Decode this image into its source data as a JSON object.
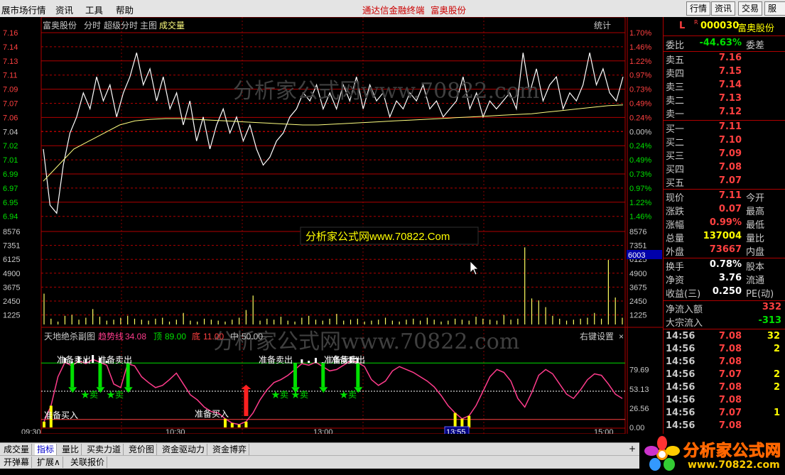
{
  "menubar": {
    "items": [
      "展市场行情",
      "资讯",
      "工具",
      "帮助"
    ],
    "title_app": "通达信金融终端",
    "title_stock": "富奥股份",
    "right_buttons": [
      "行情",
      "资讯",
      "交易",
      "服务"
    ]
  },
  "chart_header": {
    "stock_name": "富奥股份",
    "mode_fenshi": "分时",
    "mode_super": "超级分时",
    "mode_main": "主图",
    "volume_label": "成交量",
    "stats_button": "统计"
  },
  "colors": {
    "up": "#ff4040",
    "down": "#00e000",
    "grid": "#b00000",
    "price_line": "#ffffff",
    "avg_line": "#ffff80",
    "indicator": "#ff3c8c"
  },
  "chart_data": [
    {
      "type": "line",
      "name": "intraday-price",
      "y_ticks": [
        "7.16",
        "7.14",
        "7.13",
        "7.11",
        "7.09",
        "7.07",
        "7.06",
        "7.04",
        "7.02",
        "7.01",
        "6.99",
        "6.97",
        "6.95",
        "6.94"
      ],
      "pct_ticks": [
        "1.70%",
        "1.46%",
        "1.22%",
        "0.97%",
        "0.73%",
        "0.49%",
        "0.24%",
        "0.00%",
        "0.24%",
        "0.49%",
        "0.73%",
        "0.97%",
        "1.22%",
        "1.46%"
      ],
      "ylim": [
        6.935,
        7.165
      ],
      "price": [
        7.02,
        6.95,
        6.94,
        7.0,
        7.04,
        7.06,
        7.09,
        7.07,
        7.11,
        7.08,
        7.1,
        7.06,
        7.09,
        7.11,
        7.14,
        7.1,
        7.12,
        7.08,
        7.11,
        7.07,
        7.09,
        7.05,
        7.08,
        7.03,
        7.06,
        7.02,
        7.05,
        7.07,
        7.04,
        7.06,
        7.03,
        7.05,
        7.02,
        7.0,
        7.01,
        7.03,
        7.04,
        7.06,
        7.07,
        7.09,
        7.08,
        7.1,
        7.07,
        7.09,
        7.07,
        7.1,
        7.08,
        7.11,
        7.07,
        7.1,
        7.08,
        7.09,
        7.06,
        7.08,
        7.07,
        7.09,
        7.08,
        7.1,
        7.07,
        7.08,
        7.06,
        7.07,
        7.08,
        7.11,
        7.07,
        7.09,
        7.06,
        7.08,
        7.07,
        7.08,
        7.09,
        7.07,
        7.14,
        7.09,
        7.12,
        7.08,
        7.1,
        7.11,
        7.07,
        7.09,
        7.08,
        7.1,
        7.14,
        7.1,
        7.12,
        7.09,
        7.08,
        7.11
      ],
      "avg": [
        6.98,
        7.0,
        7.02,
        7.03,
        7.04,
        7.05,
        7.055,
        7.057,
        7.058,
        7.058,
        7.057,
        7.056,
        7.055,
        7.054,
        7.053,
        7.052,
        7.051,
        7.05,
        7.05,
        7.051,
        7.052,
        7.053,
        7.054,
        7.055,
        7.056,
        7.057,
        7.058,
        7.059,
        7.06,
        7.061,
        7.062,
        7.063,
        7.064,
        7.066,
        7.068,
        7.07,
        7.072,
        7.074,
        7.075
      ],
      "x_ticks": [
        "09:30",
        "10:30",
        "13:00",
        "13:55",
        "15:00"
      ]
    },
    {
      "type": "bar",
      "name": "volume",
      "y_ticks": [
        "8576",
        "7351",
        "6125",
        "4900",
        "3675",
        "2450",
        "1225"
      ],
      "ylim": [
        0,
        9800
      ],
      "highlight_value": "6003",
      "values": [
        3200,
        600,
        300,
        900,
        1000,
        500,
        700,
        1600,
        800,
        400,
        500,
        700,
        900,
        600,
        500,
        400,
        600,
        700,
        300,
        500,
        1200,
        400,
        300,
        600,
        500,
        400,
        300,
        500,
        700,
        1500,
        3000,
        400,
        600,
        500,
        800,
        400,
        300,
        700,
        900,
        500,
        400,
        600,
        1100,
        400,
        500,
        600,
        300,
        400,
        500,
        700,
        400,
        300,
        500,
        600,
        400,
        700,
        500,
        300,
        400,
        600,
        500,
        400,
        800,
        600,
        500,
        400,
        1000,
        500,
        600,
        8000,
        2700,
        2500,
        1800,
        900,
        600,
        400,
        500,
        600,
        700,
        1200,
        600,
        6700,
        2800,
        700
      ]
    },
    {
      "type": "line",
      "name": "天地绝杀副图",
      "title": "天地绝杀副图",
      "legend": [
        {
          "name": "趋势线",
          "value": "34.08"
        },
        {
          "name": "顶",
          "value": "89.00"
        },
        {
          "name": "底",
          "value": "11.00"
        },
        {
          "name": "中",
          "value": "50.00"
        }
      ],
      "settings_label": "右键设置",
      "y_ticks": [
        "79.69",
        "53.13",
        "26.56",
        "0.00"
      ],
      "ylim": [
        0,
        100
      ],
      "trend": [
        8,
        30,
        70,
        90,
        85,
        92,
        88,
        94,
        90,
        86,
        60,
        55,
        88,
        85,
        70,
        62,
        55,
        58,
        66,
        75,
        60,
        45,
        38,
        28,
        22,
        20,
        12,
        6,
        4,
        8,
        20,
        38,
        52,
        62,
        66,
        72,
        80,
        88,
        86,
        90,
        84,
        78,
        80,
        86,
        92,
        90,
        84,
        66,
        58,
        64,
        78,
        84,
        80,
        76,
        70,
        64,
        56,
        44,
        30,
        20,
        12,
        16,
        30,
        50,
        70,
        80,
        76,
        64,
        40,
        28,
        48,
        72,
        80,
        74,
        60,
        46,
        40,
        52,
        66,
        74,
        72,
        60,
        46,
        40
      ],
      "signals": [
        {
          "text": "准备买入"
        },
        {
          "text": "准备卖出"
        },
        {
          "text": "准备卖出"
        },
        {
          "text": "★卖"
        },
        {
          "text": "★卖"
        },
        {
          "text": "准备买入"
        },
        {
          "text": "准备卖出"
        },
        {
          "text": "准备卖出"
        },
        {
          "text": "★卖"
        },
        {
          "text": "★卖"
        },
        {
          "text": "准备卖出"
        },
        {
          "text": "★卖"
        }
      ]
    }
  ],
  "watermarks": [
    "分析家公式网www.70822.com",
    "分析家公式网www.70822.com",
    "分析家公式网www.70822.Com"
  ],
  "time_cursor": "13:55",
  "quote_panel": {
    "marker": "L",
    "code": "000030",
    "name": "富奥股份",
    "weibi_label": "委比",
    "weibi_value": "-44.63%",
    "weicha_label": "委差",
    "asks": [
      {
        "label": "卖五",
        "price": "7.16"
      },
      {
        "label": "卖四",
        "price": "7.15"
      },
      {
        "label": "卖三",
        "price": "7.14"
      },
      {
        "label": "卖二",
        "price": "7.13"
      },
      {
        "label": "卖一",
        "price": "7.12"
      }
    ],
    "bids": [
      {
        "label": "买一",
        "price": "7.11"
      },
      {
        "label": "买二",
        "price": "7.10"
      },
      {
        "label": "买三",
        "price": "7.09"
      },
      {
        "label": "买四",
        "price": "7.08"
      },
      {
        "label": "买五",
        "price": "7.07"
      }
    ],
    "stats": [
      {
        "label": "现价",
        "value": "7.11",
        "label2": "今开",
        "color": "#ff4040"
      },
      {
        "label": "涨跌",
        "value": "0.07",
        "label2": "最高",
        "color": "#ff4040"
      },
      {
        "label": "涨幅",
        "value": "0.99%",
        "label2": "最低",
        "color": "#ff4040"
      },
      {
        "label": "总量",
        "value": "137004",
        "label2": "量比",
        "color": "#ffff00"
      },
      {
        "label": "外盘",
        "value": "73667",
        "label2": "内盘",
        "color": "#ff4040"
      }
    ],
    "stats2": [
      {
        "label": "换手",
        "value": "0.78%",
        "label2": "股本",
        "color": "#ffffff"
      },
      {
        "label": "净资",
        "value": "3.76",
        "label2": "流通",
        "color": "#ffffff"
      },
      {
        "label": "收益(三)",
        "value": "0.250",
        "label2": "PE(动)",
        "color": "#ffffff"
      }
    ],
    "flows": [
      {
        "label": "净流入额",
        "value": "332",
        "color": "#ff4040"
      },
      {
        "label": "大宗流入",
        "value": "-313",
        "color": "#00e000"
      }
    ],
    "ticks": [
      {
        "time": "14:56",
        "price": "7.08",
        "vol": "32",
        "pcolor": "#ff4040",
        "vcolor": "#ffff00"
      },
      {
        "time": "14:56",
        "price": "7.08",
        "vol": "2",
        "pcolor": "#ff4040",
        "vcolor": "#ffff00"
      },
      {
        "time": "14:56",
        "price": "7.08",
        "vol": "",
        "pcolor": "#ff4040",
        "vcolor": "#ffff00"
      },
      {
        "time": "14:56",
        "price": "7.07",
        "vol": "2",
        "pcolor": "#ff4040",
        "vcolor": "#ffff00"
      },
      {
        "time": "14:56",
        "price": "7.08",
        "vol": "2",
        "pcolor": "#ff4040",
        "vcolor": "#ffff00"
      },
      {
        "time": "14:56",
        "price": "7.08",
        "vol": "",
        "pcolor": "#ff4040",
        "vcolor": "#ffff00"
      },
      {
        "time": "14:56",
        "price": "7.07",
        "vol": "1",
        "pcolor": "#ff4040",
        "vcolor": "#ffff00"
      },
      {
        "time": "14:56",
        "price": "7.08",
        "vol": "",
        "pcolor": "#ff4040",
        "vcolor": "#ffff00"
      }
    ]
  },
  "bottom_tabs": [
    "成交量",
    "指标",
    "量比",
    "买卖力道",
    "竞价图",
    "资金驱动力",
    "资金博弈"
  ],
  "bottom_tabs_active": "指标",
  "bottom_tabs2": [
    "开弹幕",
    "扩展∧",
    "关联报价"
  ],
  "logo": {
    "text": "分析家公式网",
    "url": "www.70822.com"
  }
}
